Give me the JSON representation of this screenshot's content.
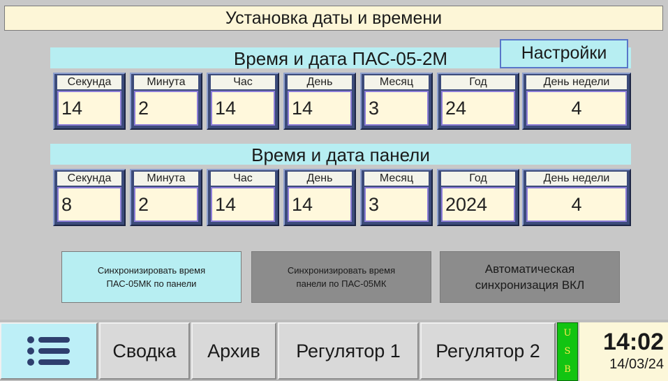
{
  "title": "Установка даты и времени",
  "settings_label": "Настройки",
  "pas": {
    "header": "Время и дата ПАС-05-2М",
    "fields": [
      {
        "label": "Секунда",
        "value": "14"
      },
      {
        "label": "Минута",
        "value": "2"
      },
      {
        "label": "Час",
        "value": "14"
      },
      {
        "label": "День",
        "value": "14"
      },
      {
        "label": "Месяц",
        "value": "3"
      },
      {
        "label": "Год",
        "value": "24"
      },
      {
        "label": "День недели",
        "value": "4"
      }
    ]
  },
  "panel": {
    "header": "Время и дата панели",
    "fields": [
      {
        "label": "Секунда",
        "value": "8"
      },
      {
        "label": "Минута",
        "value": "2"
      },
      {
        "label": "Час",
        "value": "14"
      },
      {
        "label": "День",
        "value": "14"
      },
      {
        "label": "Месяц",
        "value": "3"
      },
      {
        "label": "Год",
        "value": "2024"
      },
      {
        "label": "День недели",
        "value": "4"
      }
    ]
  },
  "buttons": {
    "sync_pas_line1": "Синхронизировать время",
    "sync_pas_line2": "ПАС-05МК по панели",
    "sync_panel_line1": "Синхронизировать время",
    "sync_panel_line2": "панели по ПАС-05МК",
    "auto_line1": "Автоматическая",
    "auto_line2": "синхронизация ВКЛ"
  },
  "nav": {
    "menu_icon": "list-menu-icon",
    "items": [
      "Сводка",
      "Архив",
      "Регулятор 1",
      "Регулятор 2"
    ]
  },
  "usb": {
    "l1": "U",
    "l2": "S",
    "l3": "B"
  },
  "clock": {
    "time": "14:02",
    "date": "14/03/24"
  },
  "colors": {
    "accent_cyan": "#b7eef2",
    "field_frame": "#3c4b7a",
    "usb_green": "#12c412",
    "button_gray": "#8c8c8c"
  }
}
